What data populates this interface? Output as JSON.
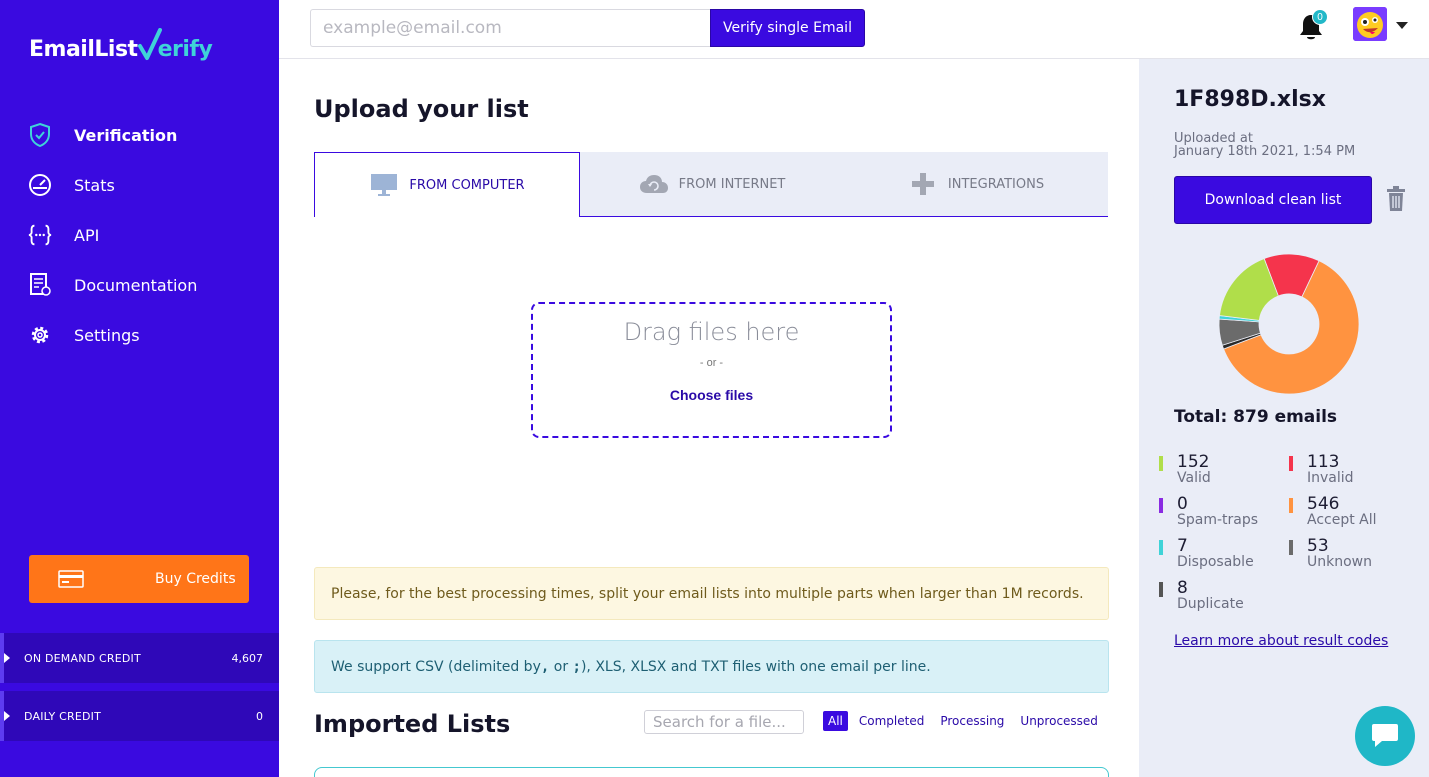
{
  "brand": {
    "name_part1": "EmailList",
    "name_part2": "erify",
    "accent": "#3fd3d8",
    "sidebar_color": "#3a0ae0"
  },
  "sidebar": {
    "items": [
      {
        "label": "Verification",
        "icon": "shield-check-icon",
        "active": true
      },
      {
        "label": "Stats",
        "icon": "gauge-icon"
      },
      {
        "label": "API",
        "icon": "braces-icon"
      },
      {
        "label": "Documentation",
        "icon": "document-icon"
      },
      {
        "label": "Settings",
        "icon": "gear-icon"
      }
    ],
    "buy_credits_label": "Buy Credits",
    "credits": [
      {
        "label": "ON DEMAND CREDIT",
        "value": "4,607"
      },
      {
        "label": "DAILY CREDIT",
        "value": "0"
      }
    ]
  },
  "topbar": {
    "email_placeholder": "example@email.com",
    "verify_label": "Verify single Email",
    "notification_count": "0"
  },
  "main": {
    "title": "Upload your list",
    "tabs": [
      {
        "label": "FROM COMPUTER",
        "icon": "monitor-icon",
        "active": true
      },
      {
        "label": "FROM INTERNET",
        "icon": "cloud-icon"
      },
      {
        "label": "INTEGRATIONS",
        "icon": "plus-icon"
      }
    ],
    "dropzone": {
      "title": "Drag files here",
      "or": "- or -",
      "choose": "Choose files"
    },
    "alert_warning": "Please, for the best processing times, split your email lists into multiple parts when larger than 1M records.",
    "alert_info": {
      "before": "We support CSV (delimited by ",
      "comma": ",",
      "or": " or ",
      "semicolon": ";",
      "after": "), XLS, XLSX and TXT files with one email per line."
    },
    "imported_title": "Imported Lists",
    "search_placeholder": "Search for a file...",
    "filters": [
      "All",
      "Completed",
      "Processing",
      "Unprocessed"
    ]
  },
  "result": {
    "file_name": "1F898D.xlsx",
    "uploaded_label": "Uploaded at",
    "uploaded_date": "January 18th 2021, 1:54 PM",
    "download_label": "Download clean list",
    "total_label": "Total: 879 emails",
    "learn_more": "Learn more about result codes"
  },
  "chart_data": {
    "type": "pie",
    "categories": [
      "Valid",
      "Invalid",
      "Spam-traps",
      "Accept All",
      "Disposable",
      "Unknown",
      "Duplicate"
    ],
    "values": [
      152,
      113,
      0,
      546,
      7,
      53,
      8
    ],
    "colors": [
      "#b0de4a",
      "#f5344c",
      "#8a2be2",
      "#ff9340",
      "#3fd3d8",
      "#6b6b6b",
      "#2a2a2a"
    ],
    "title": "Total: 879 emails",
    "donut": true
  }
}
